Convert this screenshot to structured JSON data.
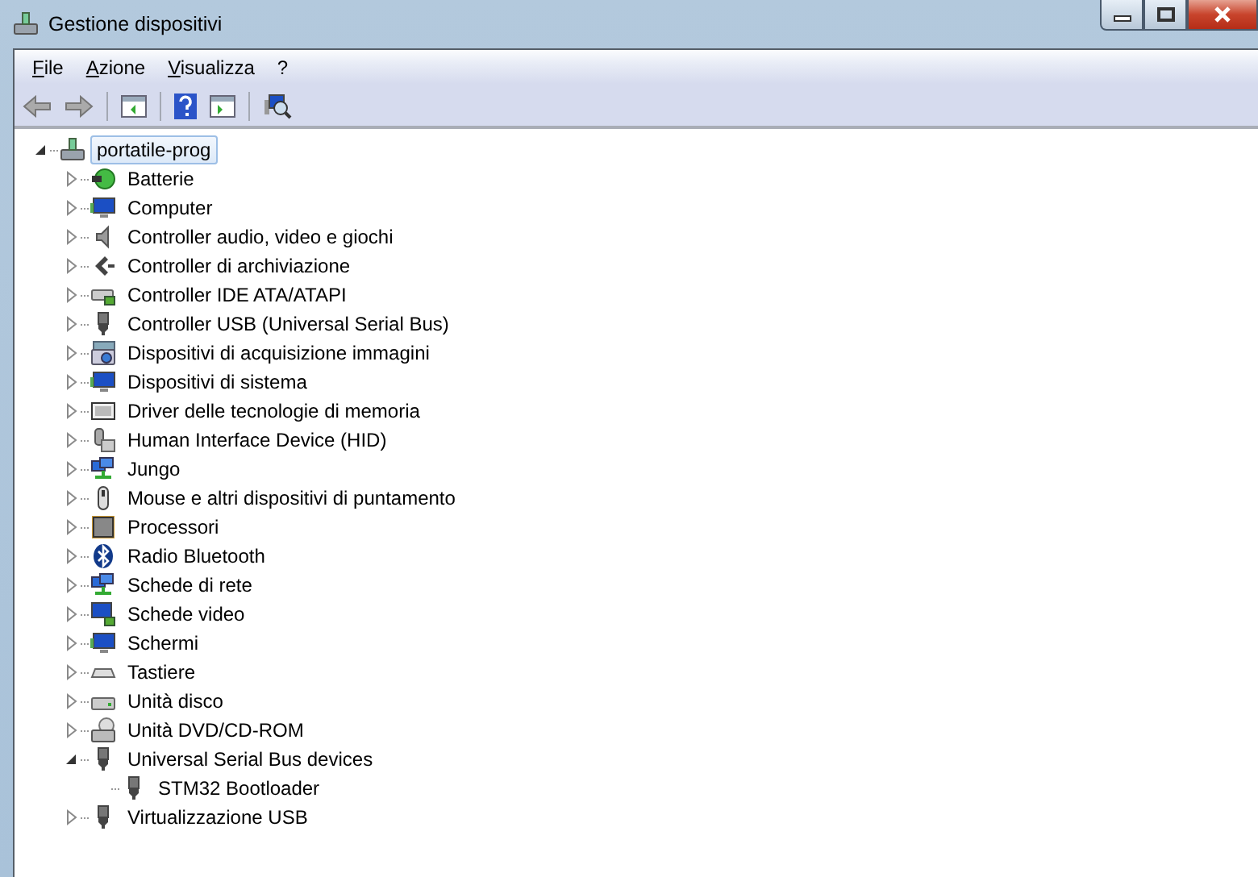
{
  "window": {
    "title": "Gestione dispositivi"
  },
  "menu": [
    "File",
    "Azione",
    "Visualizza",
    "?"
  ],
  "tree": {
    "label": "portatile-prog",
    "kind": "computer-root",
    "expanded": true,
    "selected": true,
    "children": [
      {
        "label": "Batterie",
        "kind": "battery",
        "expanded": false,
        "selected": false
      },
      {
        "label": "Computer",
        "kind": "monitor",
        "expanded": false,
        "selected": false
      },
      {
        "label": "Controller audio, video e giochi",
        "kind": "speaker",
        "expanded": false,
        "selected": false
      },
      {
        "label": "Controller di archiviazione",
        "kind": "storage",
        "expanded": false,
        "selected": false
      },
      {
        "label": "Controller IDE ATA/ATAPI",
        "kind": "ide",
        "expanded": false,
        "selected": false
      },
      {
        "label": "Controller USB (Universal Serial Bus)",
        "kind": "usb",
        "expanded": false,
        "selected": false
      },
      {
        "label": "Dispositivi di acquisizione immagini",
        "kind": "camera",
        "expanded": false,
        "selected": false
      },
      {
        "label": "Dispositivi di sistema",
        "kind": "monitor",
        "expanded": false,
        "selected": false
      },
      {
        "label": "Driver delle tecnologie di memoria",
        "kind": "memory",
        "expanded": false,
        "selected": false
      },
      {
        "label": "Human Interface Device (HID)",
        "kind": "hid",
        "expanded": false,
        "selected": false
      },
      {
        "label": "Jungo",
        "kind": "network",
        "expanded": false,
        "selected": false
      },
      {
        "label": "Mouse e altri dispositivi di puntamento",
        "kind": "mouse",
        "expanded": false,
        "selected": false
      },
      {
        "label": "Processori",
        "kind": "cpu",
        "expanded": false,
        "selected": false
      },
      {
        "label": "Radio Bluetooth",
        "kind": "bluetooth",
        "expanded": false,
        "selected": false
      },
      {
        "label": "Schede di rete",
        "kind": "network",
        "expanded": false,
        "selected": false
      },
      {
        "label": "Schede video",
        "kind": "display-adapter",
        "expanded": false,
        "selected": false
      },
      {
        "label": "Schermi",
        "kind": "monitor",
        "expanded": false,
        "selected": false
      },
      {
        "label": "Tastiere",
        "kind": "keyboard",
        "expanded": false,
        "selected": false
      },
      {
        "label": "Unità disco",
        "kind": "disk",
        "expanded": false,
        "selected": false
      },
      {
        "label": "Unità DVD/CD-ROM",
        "kind": "dvd",
        "expanded": false,
        "selected": false
      },
      {
        "label": "Universal Serial Bus devices",
        "kind": "usb",
        "expanded": true,
        "selected": false,
        "children": [
          {
            "label": "STM32 Bootloader",
            "kind": "usb",
            "selected": false
          }
        ]
      },
      {
        "label": "Virtualizzazione USB",
        "kind": "usb",
        "expanded": false,
        "selected": false
      }
    ]
  }
}
